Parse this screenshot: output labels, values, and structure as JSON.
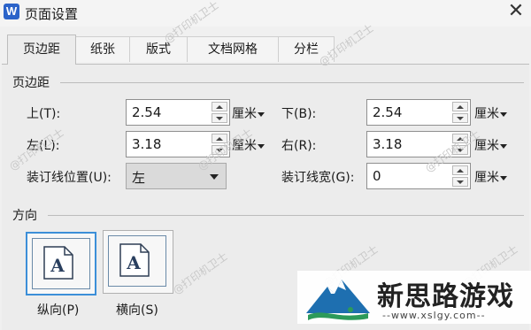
{
  "window": {
    "app_icon": "W",
    "title": "页面设置",
    "close": "✕"
  },
  "tabs": [
    {
      "label": "页边距",
      "active": true
    },
    {
      "label": "纸张",
      "active": false
    },
    {
      "label": "版式",
      "active": false
    },
    {
      "label": "文档网格",
      "active": false
    },
    {
      "label": "分栏",
      "active": false
    }
  ],
  "margins": {
    "group_title": "页边距",
    "top_label": "上(T):",
    "top_value": "2.54",
    "bottom_label": "下(B):",
    "bottom_value": "2.54",
    "left_label": "左(L):",
    "left_value": "3.18",
    "right_label": "右(R):",
    "right_value": "3.18",
    "gutter_pos_label": "装订线位置(U):",
    "gutter_pos_value": "左",
    "gutter_label": "装订线宽(G):",
    "gutter_value": "0",
    "unit": "厘米"
  },
  "orientation": {
    "group_title": "方向",
    "portrait_label": "纵向(P)",
    "landscape_label": "横向(S)",
    "page_letter": "A",
    "selected": "portrait"
  },
  "watermark": "@打印机卫士",
  "brand": {
    "name": "新思路游戏",
    "url": "--www.xslgy.com--"
  },
  "colors": {
    "accent": "#3c8fd8",
    "app_icon": "#2b63c9"
  }
}
